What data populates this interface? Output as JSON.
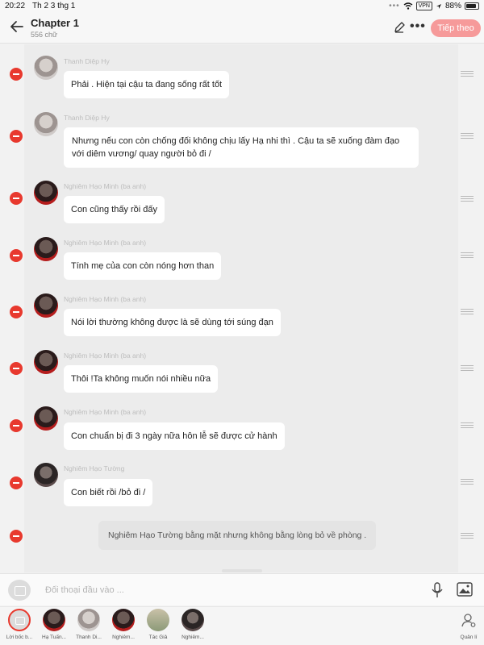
{
  "status_bar": {
    "time": "20:22",
    "date": "Th 2 3 thg 1",
    "vpn": "VPN",
    "battery": "88%",
    "battery_level": 0.88
  },
  "header": {
    "title": "Chapter 1",
    "subtitle": "556 chữ",
    "next_label": "Tiếp theo",
    "more_label": "•••"
  },
  "messages": [
    {
      "sender": "Thanh Diệp Hy",
      "text": "Phải .  Hiện tại cậu ta đang sống rất tốt"
    },
    {
      "sender": "Thanh Diệp Hy",
      "text": "Nhưng nếu con còn chống đối không chịu lấy Hạ nhi thì . Cậu ta sẽ xuống đàm đạo với diêm vương/ quay người bỏ đi /"
    },
    {
      "sender": "Nghiêm Hạo Minh (ba anh)",
      "text": "Con cũng thấy rồi đấy"
    },
    {
      "sender": "Nghiêm Hạo Minh (ba anh)",
      "text": "Tính mẹ của con còn nóng hơn than"
    },
    {
      "sender": "Nghiêm Hạo Minh (ba anh)",
      "text": "Nói lời thường không được là sẽ dùng tới súng đạn"
    },
    {
      "sender": "Nghiêm Hạo Minh (ba anh)",
      "text": "Thôi !Ta không muốn nói nhiều nữa"
    },
    {
      "sender": "Nghiêm Hạo Minh (ba anh)",
      "text": "Con chuẩn bị đi 3 ngày nữa hôn lễ sẽ được cử hành"
    },
    {
      "sender": "Nghiêm Hạo Tường",
      "text": "Con biết rồi /bỏ đi /"
    }
  ],
  "narration": "Nghiêm Hạo Tường bằng mặt nhưng không bằng lòng bỏ về phòng .",
  "input": {
    "placeholder": "Đối thoại đầu vào ..."
  },
  "characters": [
    {
      "label": "Lời bốc b..."
    },
    {
      "label": "Hạ Tuấn..."
    },
    {
      "label": "Thanh Di..."
    },
    {
      "label": "Nghiêm..."
    },
    {
      "label": "Tác Giả"
    },
    {
      "label": "Nghiêm..."
    }
  ],
  "manage_label": "Quản lí",
  "colors": {
    "accent": "#f69a9a",
    "remove": "#e8392e"
  }
}
